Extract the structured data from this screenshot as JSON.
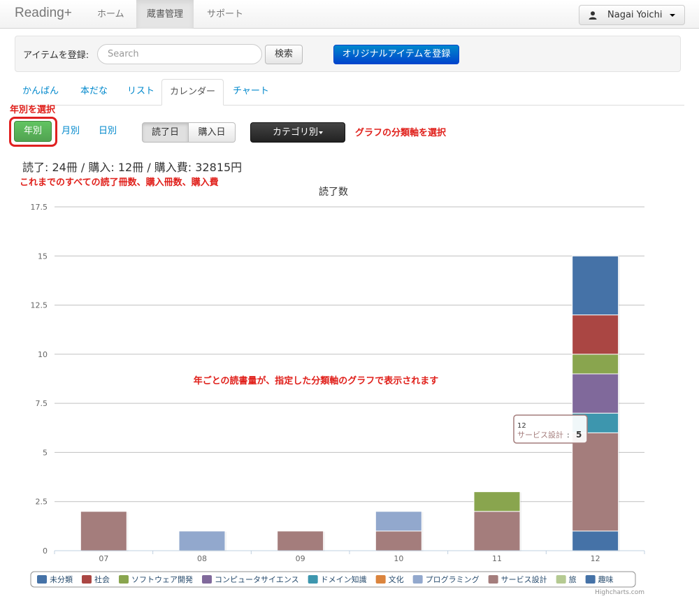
{
  "navbar": {
    "brand": "Reading+",
    "items": [
      {
        "label": "ホーム"
      },
      {
        "label": "蔵書管理"
      },
      {
        "label": "サポート"
      }
    ],
    "user": "Nagai Yoichi"
  },
  "register": {
    "label": "アイテムを登録:",
    "search_placeholder": "Search",
    "search_button": "検索",
    "original_button": "オリジナルアイテムを登録"
  },
  "tabs": [
    {
      "label": "かんばん"
    },
    {
      "label": "本だな"
    },
    {
      "label": "リスト"
    },
    {
      "label": "カレンダー"
    },
    {
      "label": "チャート"
    }
  ],
  "controls": {
    "period_year": "年別",
    "period_month": "月別",
    "period_day": "日別",
    "date_read": "読了日",
    "date_bought": "購入日",
    "category": "カテゴリ別"
  },
  "summary": "読了: 24冊 / 購入: 12冊 / 購入費: 32815円",
  "annotations": {
    "select_year": "年別を選択",
    "select_axis": "グラフの分類軸を選択",
    "all_totals": "これまでのすべての読了冊数、購入冊数、購入費",
    "chart_note": "年ごとの読書量が、指定した分類軸のグラフで表示されます"
  },
  "tooltip": {
    "category": "12",
    "series": "サービス設計",
    "value": "5"
  },
  "credit": "Highcharts.com",
  "chart_data": {
    "type": "bar",
    "stacked": true,
    "title": "読了数",
    "categories": [
      "07",
      "08",
      "09",
      "10",
      "11",
      "12"
    ],
    "ylim": [
      0,
      17.5
    ],
    "yticks": [
      0,
      2.5,
      5,
      7.5,
      10,
      12.5,
      15,
      17.5
    ],
    "ytick_labels": [
      "0",
      "2.5",
      "5",
      "7.5",
      "10",
      "12.5",
      "15",
      "17.5"
    ],
    "grid": true,
    "legend": "bottom",
    "series": [
      {
        "name": "未分類",
        "color": "#4572A7",
        "values": [
          0,
          0,
          0,
          0,
          0,
          1
        ]
      },
      {
        "name": "社会",
        "color": "#AA4643",
        "values": [
          0,
          0,
          0,
          0,
          0,
          0
        ]
      },
      {
        "name": "ソフトウェア開発",
        "color": "#89A54E",
        "values": [
          0,
          0,
          0,
          0,
          0,
          0
        ]
      },
      {
        "name": "コンピュータサイエンス",
        "color": "#80699B",
        "values": [
          0,
          0,
          0,
          0,
          0,
          0
        ]
      },
      {
        "name": "ドメイン知識",
        "color": "#3D96AE",
        "values": [
          0,
          0,
          0,
          0,
          0,
          0
        ]
      },
      {
        "name": "文化",
        "color": "#DB843D",
        "values": [
          0,
          0,
          0,
          0,
          0,
          0
        ]
      },
      {
        "name": "プログラミング",
        "color": "#92A8CD",
        "values": [
          0,
          0,
          0,
          0,
          0,
          0
        ]
      },
      {
        "name": "サービス設計",
        "color": "#A47D7C",
        "values": [
          2,
          0,
          1,
          1,
          2,
          5
        ]
      },
      {
        "name": "旅",
        "color": "#B5CA92",
        "values": [
          0,
          0,
          0,
          0,
          0,
          0
        ]
      },
      {
        "name": "趣味",
        "color": "#4572A7",
        "values": [
          0,
          0,
          0,
          0,
          0,
          0
        ]
      }
    ],
    "stacks": [
      [
        {
          "series": "サービス設計",
          "value": 2
        }
      ],
      [
        {
          "series": "プログラミング",
          "value": 1
        }
      ],
      [
        {
          "series": "サービス設計",
          "value": 1
        }
      ],
      [
        {
          "series": "サービス設計",
          "value": 1
        },
        {
          "series": "プログラミング",
          "value": 1
        }
      ],
      [
        {
          "series": "サービス設計",
          "value": 2
        },
        {
          "series": "ソフトウェア開発",
          "value": 1
        }
      ],
      [
        {
          "series": "未分類",
          "value": 1
        },
        {
          "series": "サービス設計",
          "value": 5
        },
        {
          "series": "ドメイン知識",
          "value": 1
        },
        {
          "series": "コンピュータサイエンス",
          "value": 2
        },
        {
          "series": "ソフトウェア開発",
          "value": 1
        },
        {
          "series": "社会",
          "value": 2
        },
        {
          "series": "趣味",
          "value": 3
        }
      ]
    ]
  }
}
